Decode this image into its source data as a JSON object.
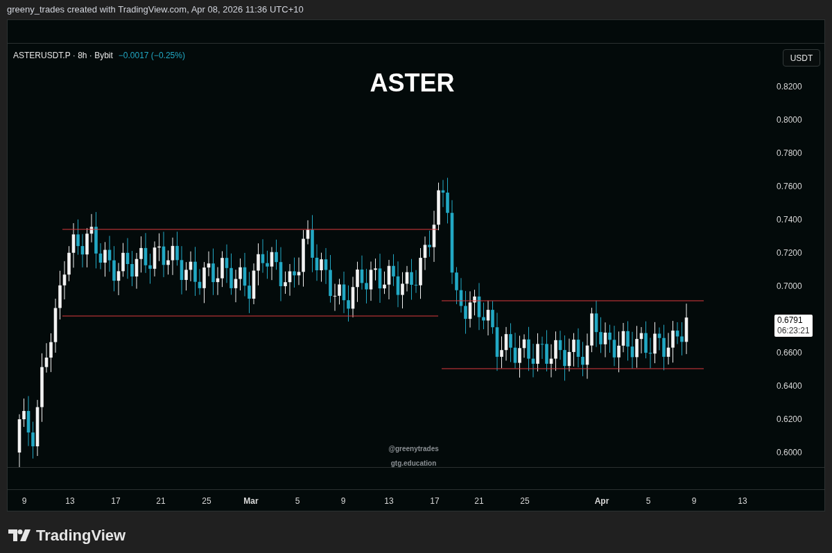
{
  "caption": "greeny_trades created with TradingView.com, Apr 08, 2026 11:36 UTC+10",
  "legend": {
    "symbol": "ASTERUSDT.P · 8h · Bybit",
    "change": "−0.0017 (−0.25%)"
  },
  "title": "ASTER",
  "currency": "USDT",
  "price_axis": {
    "above_last": [
      "0.8200",
      "0.8000",
      "0.7800",
      "0.7600",
      "0.7400",
      "0.7200",
      "0.7000"
    ],
    "below_last": [
      "0.6600",
      "0.6400",
      "0.6200",
      "0.6000"
    ]
  },
  "last_price": {
    "value": "0.6791",
    "countdown": "06:23:21"
  },
  "watermark": [
    "@greenytrades",
    "gtg.education"
  ],
  "time_axis": [
    {
      "label": "9",
      "kind": "day"
    },
    {
      "label": "13",
      "kind": "day"
    },
    {
      "label": "17",
      "kind": "day"
    },
    {
      "label": "21",
      "kind": "day"
    },
    {
      "label": "25",
      "kind": "day"
    },
    {
      "label": "Mar",
      "kind": "month"
    },
    {
      "label": "5",
      "kind": "day"
    },
    {
      "label": "9",
      "kind": "day"
    },
    {
      "label": "13",
      "kind": "day"
    },
    {
      "label": "17",
      "kind": "day"
    },
    {
      "label": "21",
      "kind": "day"
    },
    {
      "label": "25",
      "kind": "day"
    },
    {
      "label": "Apr",
      "kind": "month"
    },
    {
      "label": "5",
      "kind": "day"
    },
    {
      "label": "9",
      "kind": "day"
    },
    {
      "label": "13",
      "kind": "day"
    }
  ],
  "brand": "TradingView"
}
